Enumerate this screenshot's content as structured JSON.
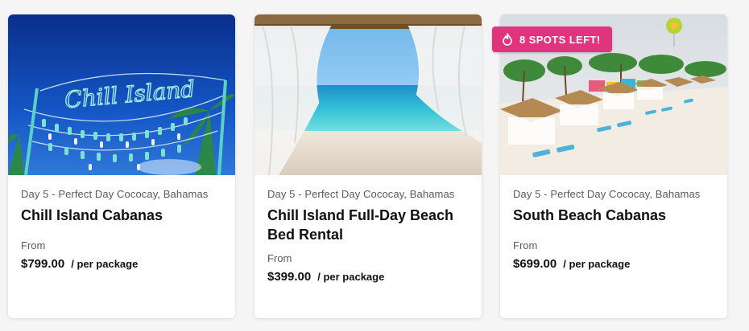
{
  "cards": [
    {
      "image_alt": "Chill Island sign with hanging buoys",
      "image_sign_text": "Chill Island",
      "day": "Day 5 - Perfect Day Cococay, Bahamas",
      "title": "Chill Island Cabanas",
      "from_label": "From",
      "price": "$799.00",
      "per": "/ per package"
    },
    {
      "image_alt": "Beach bed with white curtains facing turquoise sea",
      "day": "Day 5 - Perfect Day Cococay, Bahamas",
      "title": "Chill Island Full-Day Beach Bed Rental",
      "from_label": "From",
      "price": "$399.00",
      "per": "/ per package"
    },
    {
      "image_alt": "Row of thatched beach cabanas with lounge chairs",
      "badge": "8 SPOTS LEFT!",
      "badge_icon": "flame-icon",
      "day": "Day 5 - Perfect Day Cococay, Bahamas",
      "title": "South Beach Cabanas",
      "from_label": "From",
      "price": "$699.00",
      "per": "/ per package"
    }
  ],
  "colors": {
    "badge": "#e0347e",
    "title": "#111111",
    "muted": "#5a5a5a"
  }
}
